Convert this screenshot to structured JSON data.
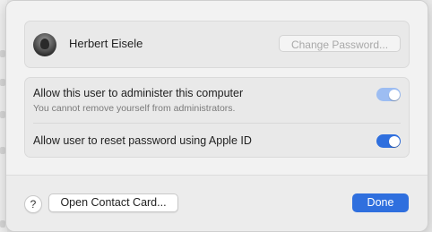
{
  "user": {
    "name": "Herbert Eisele",
    "change_password_label": "Change Password..."
  },
  "settings": {
    "admin": {
      "title": "Allow this user to administer this computer",
      "subtitle": "You cannot remove yourself from administrators.",
      "enabled": true,
      "locked": true
    },
    "apple_id_reset": {
      "title": "Allow user to reset password using Apple ID",
      "enabled": true
    }
  },
  "footer": {
    "help_label": "?",
    "contact_card_label": "Open Contact Card...",
    "done_label": "Done"
  },
  "colors": {
    "accent": "#2f6fde",
    "accent_disabled": "#9dbdf2"
  },
  "icons": {
    "avatar": "user-avatar-photo"
  }
}
